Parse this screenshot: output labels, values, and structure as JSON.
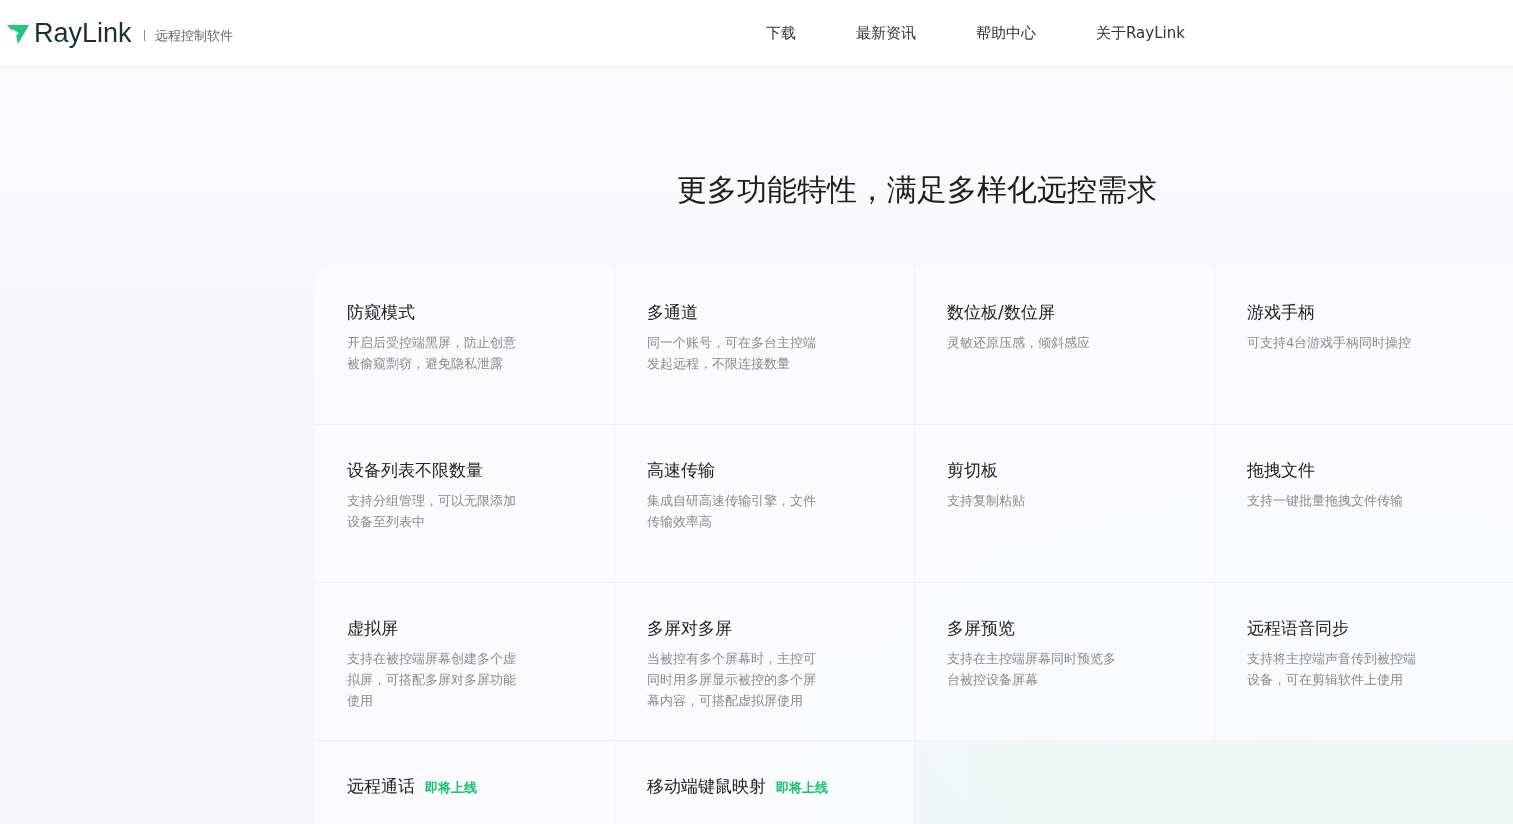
{
  "header": {
    "logo": "RayLink",
    "tagline": "远程控制软件",
    "nav": [
      {
        "label": "下载"
      },
      {
        "label": "最新资讯"
      },
      {
        "label": "帮助中心"
      },
      {
        "label": "关于RayLink"
      }
    ]
  },
  "section": {
    "title": "更多功能特性，满足多样化远控需求",
    "features": [
      {
        "title": "防窥模式",
        "lines": [
          "开启后受控端黑屏，防止创意",
          "被偷窥剽窃，避免隐私泄露"
        ]
      },
      {
        "title": "多通道",
        "lines": [
          "同一个账号，可在多台主控端",
          "发起远程，不限连接数量"
        ]
      },
      {
        "title": "数位板/数位屏",
        "lines": [
          "灵敏还原压感，倾斜感应"
        ]
      },
      {
        "title": "游戏手柄",
        "lines": [
          "可支持4台游戏手柄同时操控"
        ]
      },
      {
        "title": "设备列表不限数量",
        "lines": [
          "支持分组管理，可以无限添加",
          "设备至列表中"
        ]
      },
      {
        "title": "高速传输",
        "lines": [
          "集成自研高速传输引擎，文件",
          "传输效率高"
        ]
      },
      {
        "title": "剪切板",
        "lines": [
          "支持复制粘贴"
        ]
      },
      {
        "title": "拖拽文件",
        "lines": [
          "支持一键批量拖拽文件传输"
        ]
      },
      {
        "title": "虚拟屏",
        "lines": [
          "支持在被控端屏幕创建多个虚",
          "拟屏，可搭配多屏对多屏功能",
          "使用"
        ]
      },
      {
        "title": "多屏对多屏",
        "lines": [
          "当被控有多个屏幕时，主控可",
          "同时用多屏显示被控的多个屏",
          "幕内容，可搭配虚拟屏使用"
        ]
      },
      {
        "title": "多屏预览",
        "lines": [
          "支持在主控端屏幕同时预览多",
          "台被控设备屏幕"
        ]
      },
      {
        "title": "远程语音同步",
        "lines": [
          "支持将主控端声音传到被控端",
          "设备，可在剪辑软件上使用"
        ]
      },
      {
        "title": "远程通话",
        "badge": "即将上线"
      },
      {
        "title": "移动端键鼠映射",
        "badge": "即将上线"
      }
    ]
  }
}
